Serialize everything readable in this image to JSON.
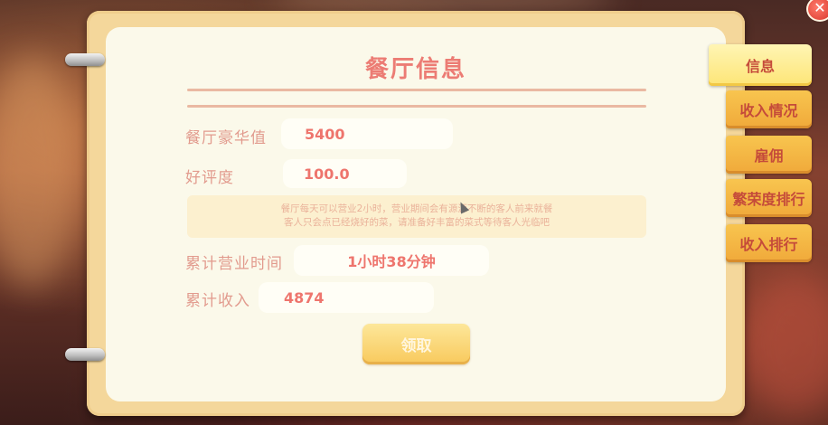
{
  "panel": {
    "title": "餐厅信息",
    "luxury": {
      "label": "餐厅豪华值",
      "value": "5400"
    },
    "rating": {
      "label": "好评度",
      "value": "100.0"
    },
    "notice": {
      "line1": "餐厅每天可以营业2小时，营业期间会有源源不断的客人前来就餐",
      "line2": "客人只会点已经烧好的菜，请准备好丰富的菜式等待客人光临吧"
    },
    "business_time": {
      "label": "累计营业时间",
      "value": "1小时38分钟"
    },
    "total_income": {
      "label": "累计收入",
      "value": "4874"
    },
    "claim_label": "领取"
  },
  "tabs": [
    {
      "label": "信息",
      "active": true
    },
    {
      "label": "收入情况",
      "active": false
    },
    {
      "label": "雇佣",
      "active": false
    },
    {
      "label": "繁荣度排行",
      "active": false
    },
    {
      "label": "收入排行",
      "active": false
    }
  ],
  "close_label": "✕",
  "colors": {
    "accent": "#ec7c74",
    "tab": "#f8c54f",
    "tab_active": "#fde576",
    "paper": "#fbf9ea"
  }
}
